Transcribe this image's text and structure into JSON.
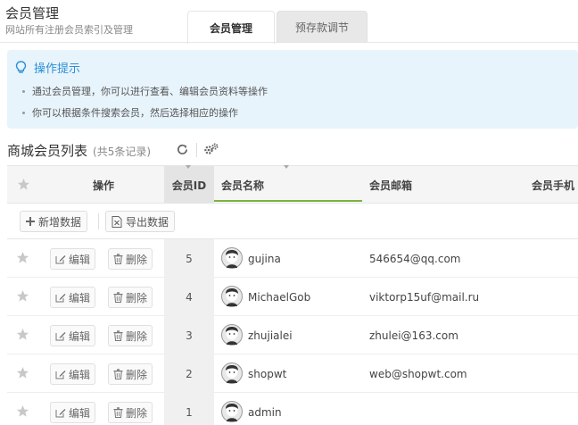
{
  "header": {
    "title": "会员管理",
    "subtitle": "网站所有注册会员索引及管理",
    "tabs": [
      {
        "label": "会员管理",
        "active": true
      },
      {
        "label": "预存款调节",
        "active": false
      }
    ]
  },
  "tips": {
    "title": "操作提示",
    "items": [
      "通过会员管理，你可以进行查看、编辑会员资料等操作",
      "你可以根据条件搜索会员，然后选择相应的操作"
    ]
  },
  "list": {
    "title": "商城会员列表",
    "count": "(共5条记录)"
  },
  "table": {
    "columns": {
      "action": "操作",
      "id": "会员ID",
      "name": "会员名称",
      "email": "会员邮箱",
      "phone": "会员手机"
    },
    "toolbar": {
      "add": "新增数据",
      "export": "导出数据"
    },
    "edit_label": "编辑",
    "delete_label": "删除",
    "rows": [
      {
        "id": "5",
        "name": "gujina",
        "email": "546654@qq.com"
      },
      {
        "id": "4",
        "name": "MichaelGob",
        "email": "viktorp15uf@mail.ru"
      },
      {
        "id": "3",
        "name": "zhujialei",
        "email": "zhulei@163.com"
      },
      {
        "id": "2",
        "name": "shopwt",
        "email": "web@shopwt.com"
      },
      {
        "id": "1",
        "name": "admin",
        "email": ""
      }
    ]
  },
  "colors": {
    "accent": "#2b8fd6",
    "tips_bg": "#e8f4fc",
    "sort_underline": "#7cb342"
  }
}
